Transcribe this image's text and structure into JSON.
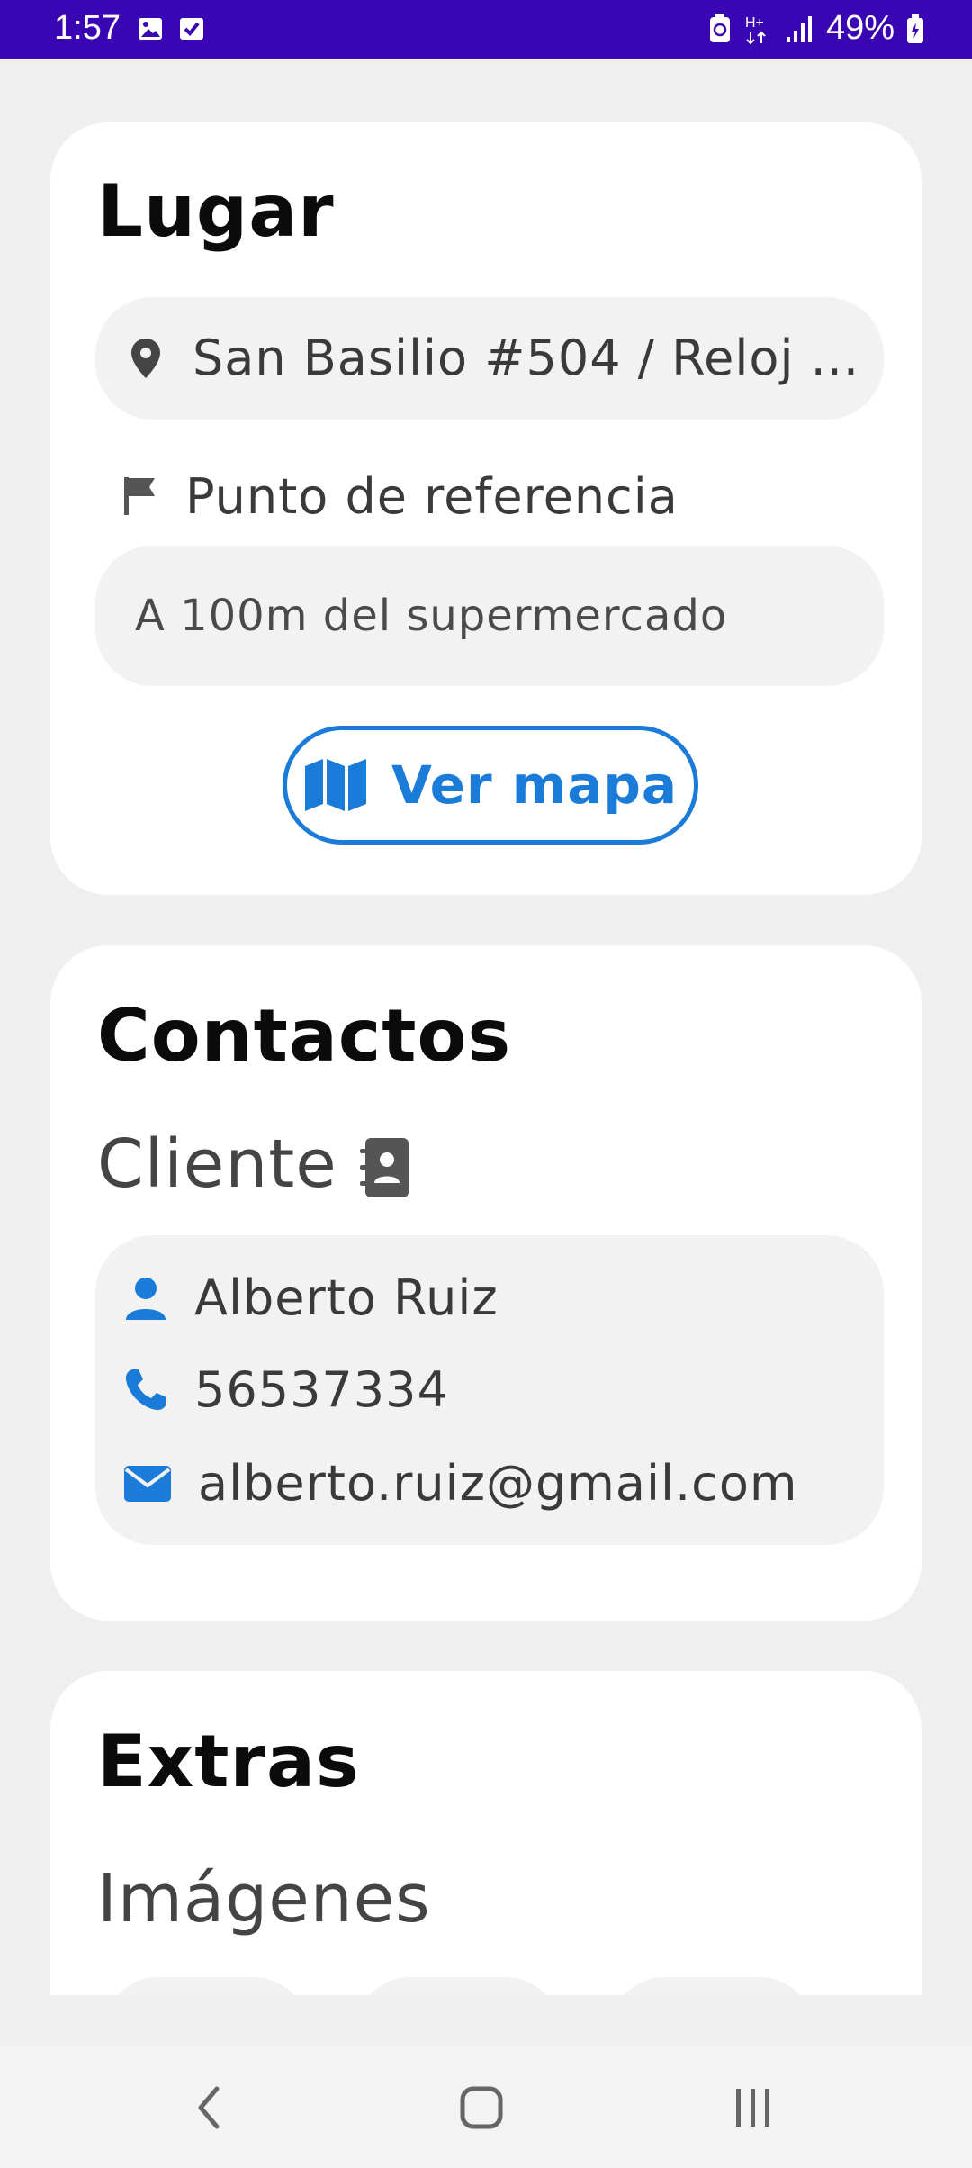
{
  "status_bar": {
    "time": "1:57",
    "battery": "49%",
    "network": "H+"
  },
  "lugar": {
    "title": "Lugar",
    "address": "San Basilio #504 / Reloj ...",
    "reference_label": "Punto de referencia",
    "reference_value": "A 100m del supermercado",
    "map_button": "Ver mapa"
  },
  "contactos": {
    "title": "Contactos",
    "client_heading": "Cliente",
    "name": "Alberto Ruiz",
    "phone": "56537334",
    "email": "alberto.ruiz@gmail.com"
  },
  "extras": {
    "title": "Extras",
    "images_heading": "Imágenes"
  },
  "colors": {
    "status_bar": "#3a06b3",
    "accent": "#1a7bd8",
    "background": "#efefef",
    "card": "#ffffff"
  }
}
